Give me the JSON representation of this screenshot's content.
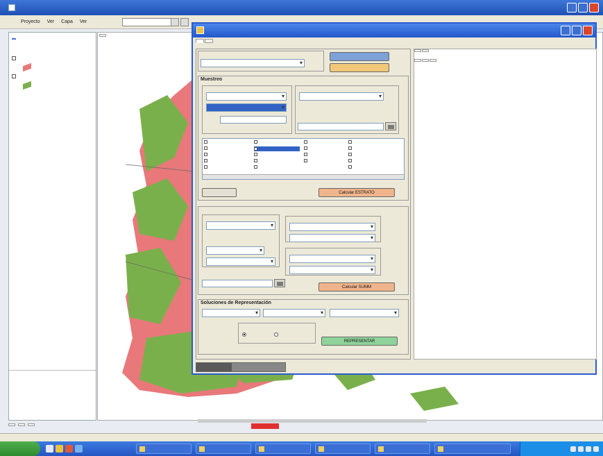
{
  "window": {
    "title": ""
  },
  "menu": [
    "Proyecto",
    "Ver",
    "Capa",
    "Ver"
  ],
  "layers_panel": {
    "items": [
      {
        "label": "",
        "selected": true
      },
      {
        "label": "",
        "selected": false
      },
      {
        "label": "",
        "selected": false
      }
    ]
  },
  "map": {
    "tab_label": "",
    "colors": {
      "salmon": "#e8787a",
      "green": "#7ab04c"
    }
  },
  "dialog": {
    "title": "",
    "tabs": [
      "",
      ""
    ],
    "sections": {
      "muestreo": {
        "title": "Muestreo"
      },
      "soluciones": {
        "title": "Soluciones de Representación"
      }
    },
    "buttons": {
      "btn1": "",
      "btn2": "",
      "calculate_estrato": "Calcular ESTRATO",
      "calculate_summ": "Calcular SUMM",
      "representar": "REPRESENTAR"
    },
    "radio": {
      "opt1": "",
      "opt2": ""
    }
  },
  "right_pane": {
    "tabs_row1": [
      "",
      ""
    ],
    "tabs_row2": [
      "",
      "",
      ""
    ]
  },
  "bottom_tabs": [
    "",
    "",
    ""
  ],
  "taskbar": {
    "start": "",
    "tasks": [
      "",
      "",
      "",
      "",
      "",
      ""
    ]
  },
  "status": {
    "text": ""
  }
}
